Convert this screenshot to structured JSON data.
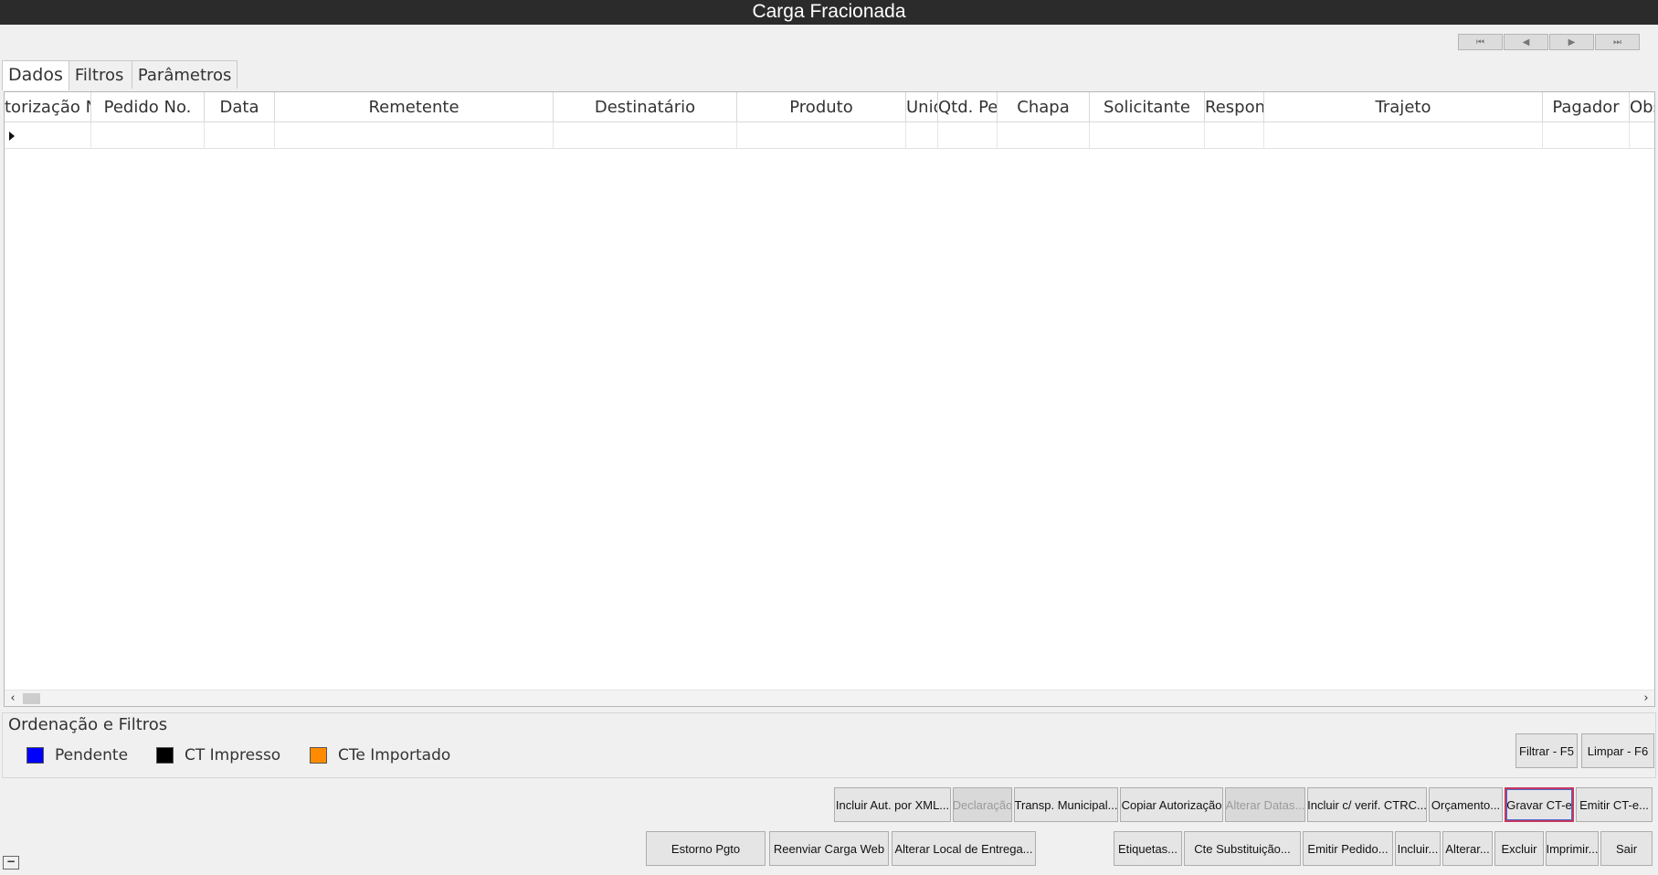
{
  "window": {
    "title": "Carga Fracionada"
  },
  "nav": {
    "first": "⏮",
    "prev": "◀",
    "next": "▶",
    "last": "⏭"
  },
  "tabs": [
    "Dados",
    "Filtros",
    "Parâmetros"
  ],
  "grid": {
    "columns": [
      "torização N",
      "Pedido No.",
      "Data",
      "Remetente",
      "Destinatário",
      "Produto",
      "Unid",
      "Qtd. Pedid",
      "Chapa",
      "Solicitante",
      "Responsável",
      "Trajeto",
      "Pagador",
      "Observ"
    ],
    "rows": [
      [
        "",
        "",
        "",
        "",
        "",
        "",
        "",
        "",
        "",
        "",
        "",
        "",
        "",
        ""
      ]
    ]
  },
  "filters": {
    "title": "Ordenação e Filtros",
    "legend": [
      {
        "label": "Pendente",
        "color": "#0000ff"
      },
      {
        "label": "CT Impresso",
        "color": "#000000"
      },
      {
        "label": "CTe Importado",
        "color": "#ff8c00"
      }
    ],
    "filter_button": "Filtrar - F5",
    "clear_button": "Limpar - F6"
  },
  "actions_row1": [
    {
      "label": "Incluir Aut. por XML...",
      "enabled": true
    },
    {
      "label": "Declaração",
      "enabled": false
    },
    {
      "label": "Transp. Municipal...",
      "enabled": true
    },
    {
      "label": "Copiar Autorização",
      "enabled": true
    },
    {
      "label": "Alterar Datas...",
      "enabled": false
    },
    {
      "label": "Incluir c/ verif. CTRC...",
      "enabled": true
    },
    {
      "label": "Orçamento...",
      "enabled": true
    },
    {
      "label": "Gravar CT-e",
      "enabled": true,
      "focused": true
    },
    {
      "label": "Emitir CT-e...",
      "enabled": true
    }
  ],
  "actions_row2": [
    {
      "label": "Estorno Pgto"
    },
    {
      "label": "Reenviar Carga Web"
    },
    {
      "label": "Alterar Local de Entrega..."
    },
    {
      "label": "Etiquetas..."
    },
    {
      "label": "Cte Substituição..."
    },
    {
      "label": "Emitir Pedido..."
    },
    {
      "label": "Incluir..."
    },
    {
      "label": "Alterar..."
    },
    {
      "label": "Excluir"
    },
    {
      "label": "Imprimir..."
    },
    {
      "label": "Sair"
    }
  ],
  "minimize": "−"
}
